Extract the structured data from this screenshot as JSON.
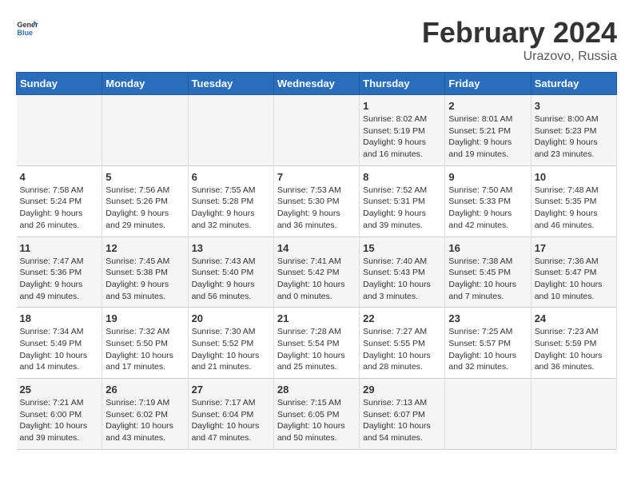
{
  "header": {
    "logo_general": "General",
    "logo_blue": "Blue",
    "month": "February 2024",
    "location": "Urazovo, Russia"
  },
  "weekdays": [
    "Sunday",
    "Monday",
    "Tuesday",
    "Wednesday",
    "Thursday",
    "Friday",
    "Saturday"
  ],
  "weeks": [
    [
      {
        "day": "",
        "text": ""
      },
      {
        "day": "",
        "text": ""
      },
      {
        "day": "",
        "text": ""
      },
      {
        "day": "",
        "text": ""
      },
      {
        "day": "1",
        "text": "Sunrise: 8:02 AM\nSunset: 5:19 PM\nDaylight: 9 hours and 16 minutes."
      },
      {
        "day": "2",
        "text": "Sunrise: 8:01 AM\nSunset: 5:21 PM\nDaylight: 9 hours and 19 minutes."
      },
      {
        "day": "3",
        "text": "Sunrise: 8:00 AM\nSunset: 5:23 PM\nDaylight: 9 hours and 23 minutes."
      }
    ],
    [
      {
        "day": "4",
        "text": "Sunrise: 7:58 AM\nSunset: 5:24 PM\nDaylight: 9 hours and 26 minutes."
      },
      {
        "day": "5",
        "text": "Sunrise: 7:56 AM\nSunset: 5:26 PM\nDaylight: 9 hours and 29 minutes."
      },
      {
        "day": "6",
        "text": "Sunrise: 7:55 AM\nSunset: 5:28 PM\nDaylight: 9 hours and 32 minutes."
      },
      {
        "day": "7",
        "text": "Sunrise: 7:53 AM\nSunset: 5:30 PM\nDaylight: 9 hours and 36 minutes."
      },
      {
        "day": "8",
        "text": "Sunrise: 7:52 AM\nSunset: 5:31 PM\nDaylight: 9 hours and 39 minutes."
      },
      {
        "day": "9",
        "text": "Sunrise: 7:50 AM\nSunset: 5:33 PM\nDaylight: 9 hours and 42 minutes."
      },
      {
        "day": "10",
        "text": "Sunrise: 7:48 AM\nSunset: 5:35 PM\nDaylight: 9 hours and 46 minutes."
      }
    ],
    [
      {
        "day": "11",
        "text": "Sunrise: 7:47 AM\nSunset: 5:36 PM\nDaylight: 9 hours and 49 minutes."
      },
      {
        "day": "12",
        "text": "Sunrise: 7:45 AM\nSunset: 5:38 PM\nDaylight: 9 hours and 53 minutes."
      },
      {
        "day": "13",
        "text": "Sunrise: 7:43 AM\nSunset: 5:40 PM\nDaylight: 9 hours and 56 minutes."
      },
      {
        "day": "14",
        "text": "Sunrise: 7:41 AM\nSunset: 5:42 PM\nDaylight: 10 hours and 0 minutes."
      },
      {
        "day": "15",
        "text": "Sunrise: 7:40 AM\nSunset: 5:43 PM\nDaylight: 10 hours and 3 minutes."
      },
      {
        "day": "16",
        "text": "Sunrise: 7:38 AM\nSunset: 5:45 PM\nDaylight: 10 hours and 7 minutes."
      },
      {
        "day": "17",
        "text": "Sunrise: 7:36 AM\nSunset: 5:47 PM\nDaylight: 10 hours and 10 minutes."
      }
    ],
    [
      {
        "day": "18",
        "text": "Sunrise: 7:34 AM\nSunset: 5:49 PM\nDaylight: 10 hours and 14 minutes."
      },
      {
        "day": "19",
        "text": "Sunrise: 7:32 AM\nSunset: 5:50 PM\nDaylight: 10 hours and 17 minutes."
      },
      {
        "day": "20",
        "text": "Sunrise: 7:30 AM\nSunset: 5:52 PM\nDaylight: 10 hours and 21 minutes."
      },
      {
        "day": "21",
        "text": "Sunrise: 7:28 AM\nSunset: 5:54 PM\nDaylight: 10 hours and 25 minutes."
      },
      {
        "day": "22",
        "text": "Sunrise: 7:27 AM\nSunset: 5:55 PM\nDaylight: 10 hours and 28 minutes."
      },
      {
        "day": "23",
        "text": "Sunrise: 7:25 AM\nSunset: 5:57 PM\nDaylight: 10 hours and 32 minutes."
      },
      {
        "day": "24",
        "text": "Sunrise: 7:23 AM\nSunset: 5:59 PM\nDaylight: 10 hours and 36 minutes."
      }
    ],
    [
      {
        "day": "25",
        "text": "Sunrise: 7:21 AM\nSunset: 6:00 PM\nDaylight: 10 hours and 39 minutes."
      },
      {
        "day": "26",
        "text": "Sunrise: 7:19 AM\nSunset: 6:02 PM\nDaylight: 10 hours and 43 minutes."
      },
      {
        "day": "27",
        "text": "Sunrise: 7:17 AM\nSunset: 6:04 PM\nDaylight: 10 hours and 47 minutes."
      },
      {
        "day": "28",
        "text": "Sunrise: 7:15 AM\nSunset: 6:05 PM\nDaylight: 10 hours and 50 minutes."
      },
      {
        "day": "29",
        "text": "Sunrise: 7:13 AM\nSunset: 6:07 PM\nDaylight: 10 hours and 54 minutes."
      },
      {
        "day": "",
        "text": ""
      },
      {
        "day": "",
        "text": ""
      }
    ]
  ]
}
